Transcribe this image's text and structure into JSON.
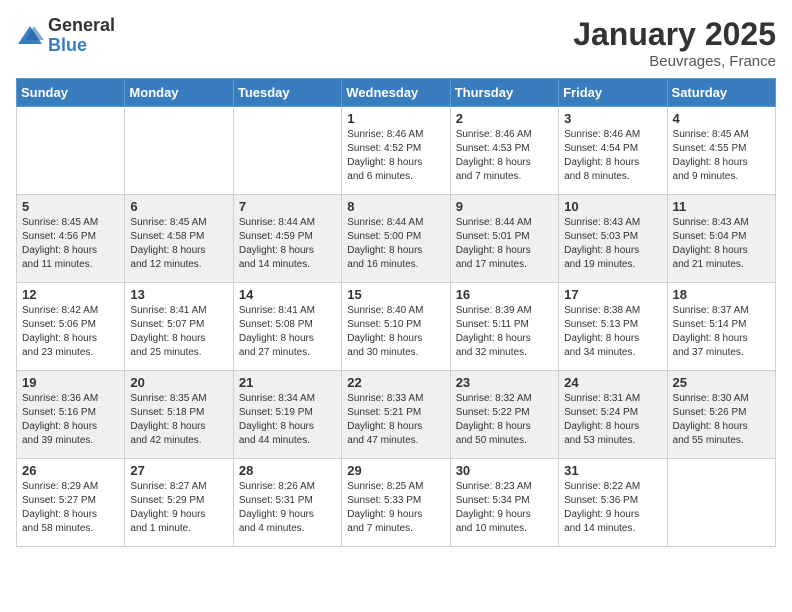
{
  "logo": {
    "general": "General",
    "blue": "Blue"
  },
  "title": "January 2025",
  "location": "Beuvrages, France",
  "days_of_week": [
    "Sunday",
    "Monday",
    "Tuesday",
    "Wednesday",
    "Thursday",
    "Friday",
    "Saturday"
  ],
  "weeks": [
    [
      {
        "day": "",
        "info": ""
      },
      {
        "day": "",
        "info": ""
      },
      {
        "day": "",
        "info": ""
      },
      {
        "day": "1",
        "info": "Sunrise: 8:46 AM\nSunset: 4:52 PM\nDaylight: 8 hours\nand 6 minutes."
      },
      {
        "day": "2",
        "info": "Sunrise: 8:46 AM\nSunset: 4:53 PM\nDaylight: 8 hours\nand 7 minutes."
      },
      {
        "day": "3",
        "info": "Sunrise: 8:46 AM\nSunset: 4:54 PM\nDaylight: 8 hours\nand 8 minutes."
      },
      {
        "day": "4",
        "info": "Sunrise: 8:45 AM\nSunset: 4:55 PM\nDaylight: 8 hours\nand 9 minutes."
      }
    ],
    [
      {
        "day": "5",
        "info": "Sunrise: 8:45 AM\nSunset: 4:56 PM\nDaylight: 8 hours\nand 11 minutes."
      },
      {
        "day": "6",
        "info": "Sunrise: 8:45 AM\nSunset: 4:58 PM\nDaylight: 8 hours\nand 12 minutes."
      },
      {
        "day": "7",
        "info": "Sunrise: 8:44 AM\nSunset: 4:59 PM\nDaylight: 8 hours\nand 14 minutes."
      },
      {
        "day": "8",
        "info": "Sunrise: 8:44 AM\nSunset: 5:00 PM\nDaylight: 8 hours\nand 16 minutes."
      },
      {
        "day": "9",
        "info": "Sunrise: 8:44 AM\nSunset: 5:01 PM\nDaylight: 8 hours\nand 17 minutes."
      },
      {
        "day": "10",
        "info": "Sunrise: 8:43 AM\nSunset: 5:03 PM\nDaylight: 8 hours\nand 19 minutes."
      },
      {
        "day": "11",
        "info": "Sunrise: 8:43 AM\nSunset: 5:04 PM\nDaylight: 8 hours\nand 21 minutes."
      }
    ],
    [
      {
        "day": "12",
        "info": "Sunrise: 8:42 AM\nSunset: 5:06 PM\nDaylight: 8 hours\nand 23 minutes."
      },
      {
        "day": "13",
        "info": "Sunrise: 8:41 AM\nSunset: 5:07 PM\nDaylight: 8 hours\nand 25 minutes."
      },
      {
        "day": "14",
        "info": "Sunrise: 8:41 AM\nSunset: 5:08 PM\nDaylight: 8 hours\nand 27 minutes."
      },
      {
        "day": "15",
        "info": "Sunrise: 8:40 AM\nSunset: 5:10 PM\nDaylight: 8 hours\nand 30 minutes."
      },
      {
        "day": "16",
        "info": "Sunrise: 8:39 AM\nSunset: 5:11 PM\nDaylight: 8 hours\nand 32 minutes."
      },
      {
        "day": "17",
        "info": "Sunrise: 8:38 AM\nSunset: 5:13 PM\nDaylight: 8 hours\nand 34 minutes."
      },
      {
        "day": "18",
        "info": "Sunrise: 8:37 AM\nSunset: 5:14 PM\nDaylight: 8 hours\nand 37 minutes."
      }
    ],
    [
      {
        "day": "19",
        "info": "Sunrise: 8:36 AM\nSunset: 5:16 PM\nDaylight: 8 hours\nand 39 minutes."
      },
      {
        "day": "20",
        "info": "Sunrise: 8:35 AM\nSunset: 5:18 PM\nDaylight: 8 hours\nand 42 minutes."
      },
      {
        "day": "21",
        "info": "Sunrise: 8:34 AM\nSunset: 5:19 PM\nDaylight: 8 hours\nand 44 minutes."
      },
      {
        "day": "22",
        "info": "Sunrise: 8:33 AM\nSunset: 5:21 PM\nDaylight: 8 hours\nand 47 minutes."
      },
      {
        "day": "23",
        "info": "Sunrise: 8:32 AM\nSunset: 5:22 PM\nDaylight: 8 hours\nand 50 minutes."
      },
      {
        "day": "24",
        "info": "Sunrise: 8:31 AM\nSunset: 5:24 PM\nDaylight: 8 hours\nand 53 minutes."
      },
      {
        "day": "25",
        "info": "Sunrise: 8:30 AM\nSunset: 5:26 PM\nDaylight: 8 hours\nand 55 minutes."
      }
    ],
    [
      {
        "day": "26",
        "info": "Sunrise: 8:29 AM\nSunset: 5:27 PM\nDaylight: 8 hours\nand 58 minutes."
      },
      {
        "day": "27",
        "info": "Sunrise: 8:27 AM\nSunset: 5:29 PM\nDaylight: 9 hours\nand 1 minute."
      },
      {
        "day": "28",
        "info": "Sunrise: 8:26 AM\nSunset: 5:31 PM\nDaylight: 9 hours\nand 4 minutes."
      },
      {
        "day": "29",
        "info": "Sunrise: 8:25 AM\nSunset: 5:33 PM\nDaylight: 9 hours\nand 7 minutes."
      },
      {
        "day": "30",
        "info": "Sunrise: 8:23 AM\nSunset: 5:34 PM\nDaylight: 9 hours\nand 10 minutes."
      },
      {
        "day": "31",
        "info": "Sunrise: 8:22 AM\nSunset: 5:36 PM\nDaylight: 9 hours\nand 14 minutes."
      },
      {
        "day": "",
        "info": ""
      }
    ]
  ]
}
